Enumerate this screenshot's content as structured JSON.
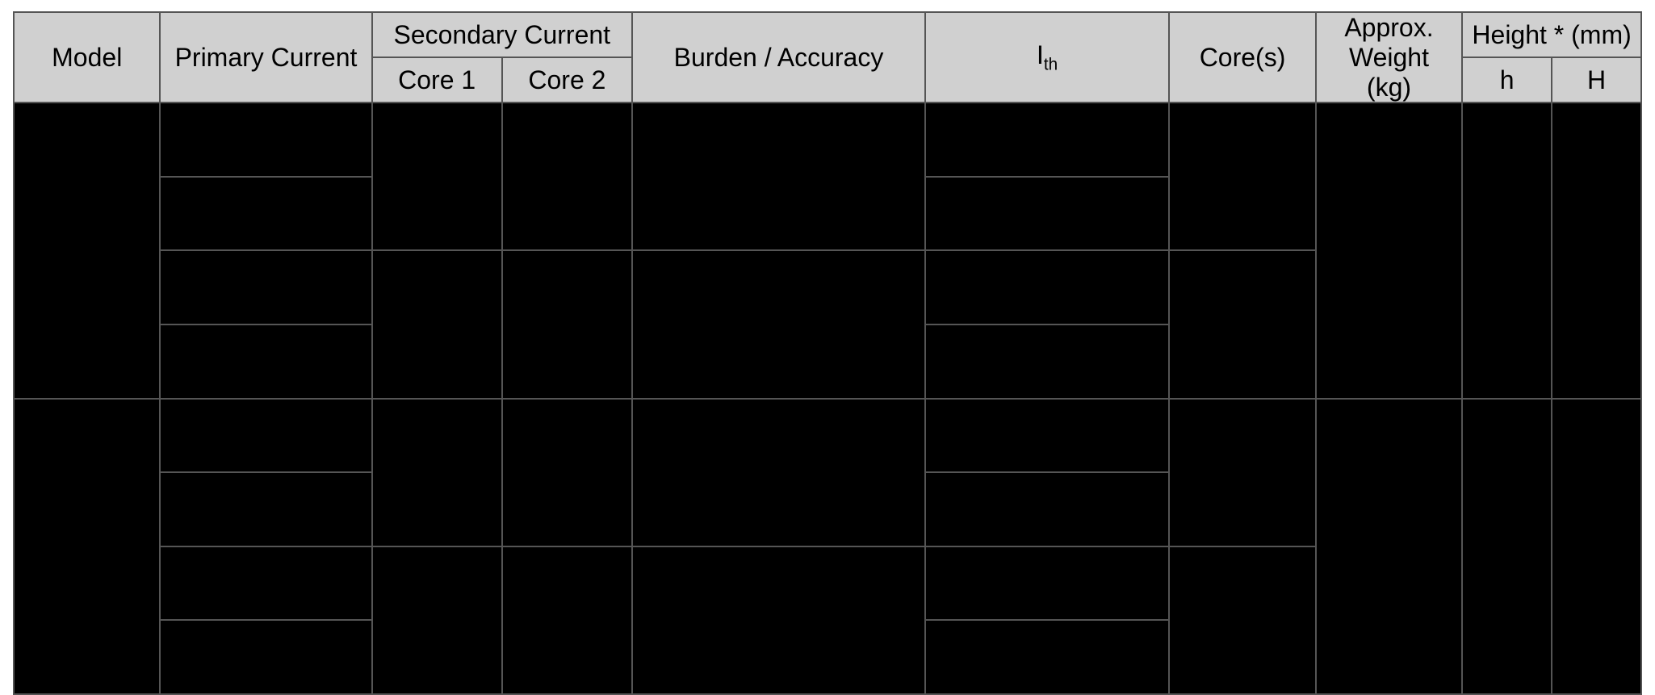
{
  "headers": {
    "model": "Model",
    "primary_current": "Primary Current",
    "secondary_current": "Secondary Current",
    "core1": "Core 1",
    "core2": "Core 2",
    "burden_accuracy": "Burden / Accuracy",
    "ith_base": "I",
    "ith_sub": "th",
    "cores": "Core(s)",
    "approx_weight": "Approx. Weight (kg)",
    "height_mm": "Height * (mm)",
    "height_h": "h",
    "height_H": "H"
  },
  "chart_data": {
    "type": "table",
    "columns": [
      "Model",
      "Primary Current",
      "Secondary Current Core 1",
      "Secondary Current Core 2",
      "Burden / Accuracy",
      "Ith",
      "Core(s)",
      "Approx. Weight (kg)",
      "Height h (mm)",
      "Height H (mm)"
    ],
    "rows": [
      [
        null,
        null,
        null,
        null,
        null,
        null,
        null,
        null,
        null,
        null
      ],
      [
        null,
        null,
        null,
        null,
        null,
        null,
        null,
        null,
        null,
        null
      ],
      [
        null,
        null,
        null,
        null,
        null,
        null,
        null,
        null,
        null,
        null
      ],
      [
        null,
        null,
        null,
        null,
        null,
        null,
        null,
        null,
        null,
        null
      ],
      [
        null,
        null,
        null,
        null,
        null,
        null,
        null,
        null,
        null,
        null
      ],
      [
        null,
        null,
        null,
        null,
        null,
        null,
        null,
        null,
        null,
        null
      ],
      [
        null,
        null,
        null,
        null,
        null,
        null,
        null,
        null,
        null,
        null
      ],
      [
        null,
        null,
        null,
        null,
        null,
        null,
        null,
        null,
        null,
        null
      ]
    ],
    "note": "Body cells are redacted/black in the source image; values are not visible."
  }
}
